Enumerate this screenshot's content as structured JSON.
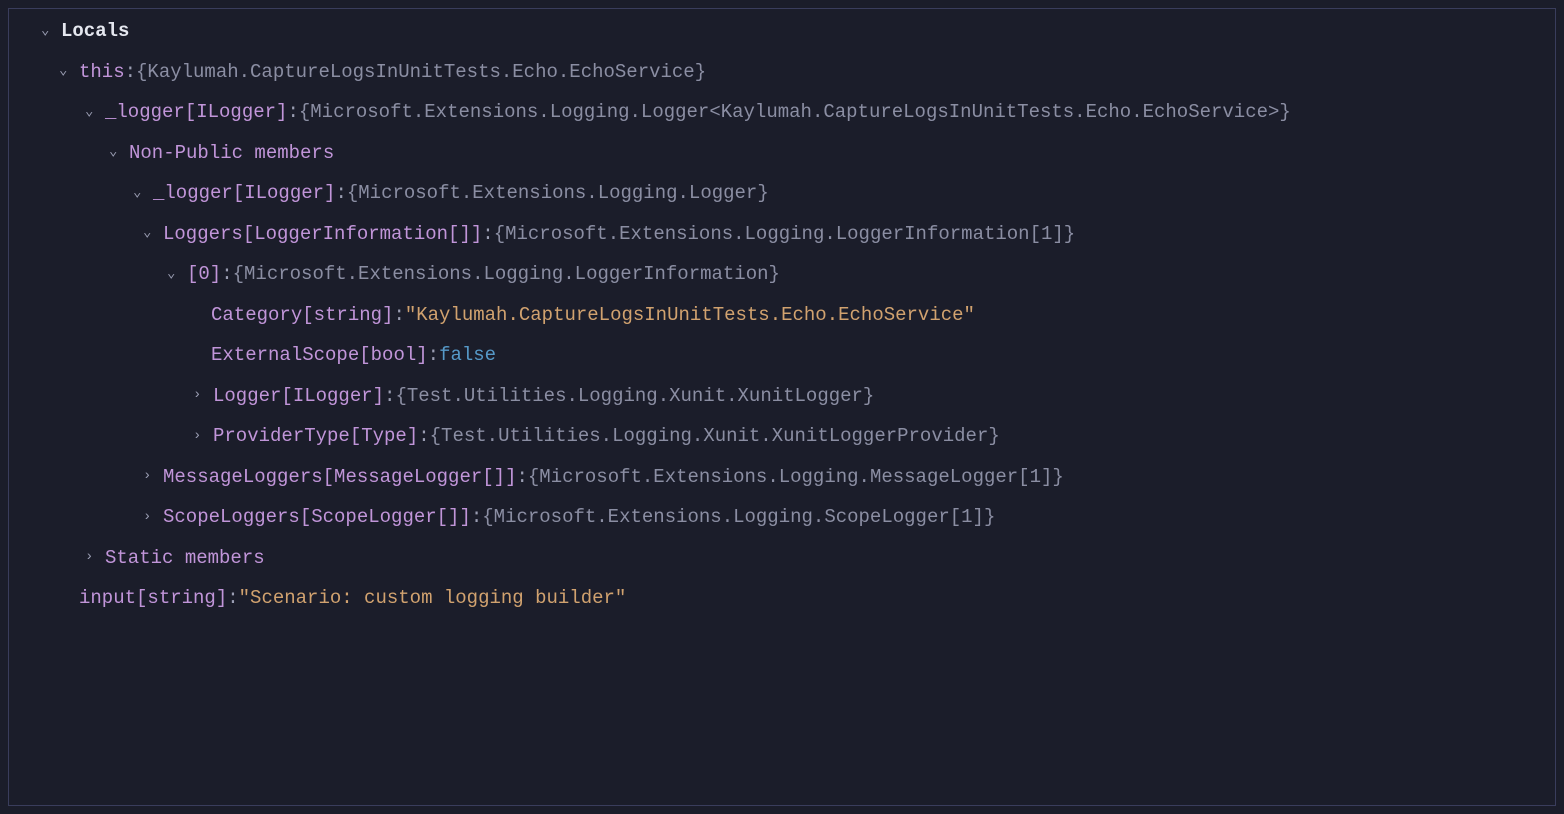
{
  "panel": {
    "title": "Locals"
  },
  "rows": [
    {
      "chevron": "down",
      "name": "this",
      "type": "",
      "colon": ":",
      "value": "{Kaylumah.CaptureLogsInUnitTests.Echo.EchoService}",
      "valueKind": "obj",
      "indent": 1
    },
    {
      "chevron": "down",
      "name": "_logger",
      "type": " [ILogger]",
      "colon": ":",
      "value": "{Microsoft.Extensions.Logging.Logger<Kaylumah.CaptureLogsInUnitTests.Echo.EchoService>}",
      "valueKind": "obj",
      "indent": 2
    },
    {
      "chevron": "down",
      "name": "Non-Public members",
      "type": "",
      "colon": "",
      "value": "",
      "valueKind": "none",
      "indent": 3
    },
    {
      "chevron": "down",
      "name": "_logger",
      "type": " [ILogger]",
      "colon": ":",
      "value": "{Microsoft.Extensions.Logging.Logger}",
      "valueKind": "obj",
      "indent": 4
    },
    {
      "chevron": "down",
      "name": "Loggers",
      "type": " [LoggerInformation[]]",
      "colon": ":",
      "value": "{Microsoft.Extensions.Logging.LoggerInformation[1]}",
      "valueKind": "obj",
      "indent": 5
    },
    {
      "chevron": "down",
      "name": "[0]",
      "type": "",
      "colon": ":",
      "value": "{Microsoft.Extensions.Logging.LoggerInformation}",
      "valueKind": "obj",
      "indent": 6
    },
    {
      "chevron": "none",
      "name": "Category",
      "type": " [string]",
      "colon": ":",
      "value": "\"Kaylumah.CaptureLogsInUnitTests.Echo.EchoService\"",
      "valueKind": "str",
      "indent": "7-noarrow"
    },
    {
      "chevron": "none",
      "name": "ExternalScope",
      "type": " [bool]",
      "colon": ":",
      "value": "false",
      "valueKind": "bool",
      "indent": "7-noarrow"
    },
    {
      "chevron": "right",
      "name": "Logger",
      "type": " [ILogger]",
      "colon": ":",
      "value": "{Test.Utilities.Logging.Xunit.XunitLogger}",
      "valueKind": "obj",
      "indent": 7
    },
    {
      "chevron": "right",
      "name": "ProviderType",
      "type": " [Type]",
      "colon": ":",
      "value": "{Test.Utilities.Logging.Xunit.XunitLoggerProvider}",
      "valueKind": "obj",
      "indent": 7
    },
    {
      "chevron": "right",
      "name": "MessageLoggers",
      "type": " [MessageLogger[]]",
      "colon": ":",
      "value": "{Microsoft.Extensions.Logging.MessageLogger[1]}",
      "valueKind": "obj",
      "indent": 5
    },
    {
      "chevron": "right",
      "name": "ScopeLoggers",
      "type": " [ScopeLogger[]]",
      "colon": ":",
      "value": "{Microsoft.Extensions.Logging.ScopeLogger[1]}",
      "valueKind": "obj",
      "indent": 5
    },
    {
      "chevron": "right",
      "name": "Static members",
      "type": "",
      "colon": "",
      "value": "",
      "valueKind": "none",
      "indent": 2
    },
    {
      "chevron": "none",
      "name": "input",
      "type": " [string]",
      "colon": ":",
      "value": "\"Scenario: custom logging builder\"",
      "valueKind": "str",
      "indent": "1-noarrow"
    }
  ],
  "chevrons": {
    "down": "⌄",
    "right": "›"
  }
}
